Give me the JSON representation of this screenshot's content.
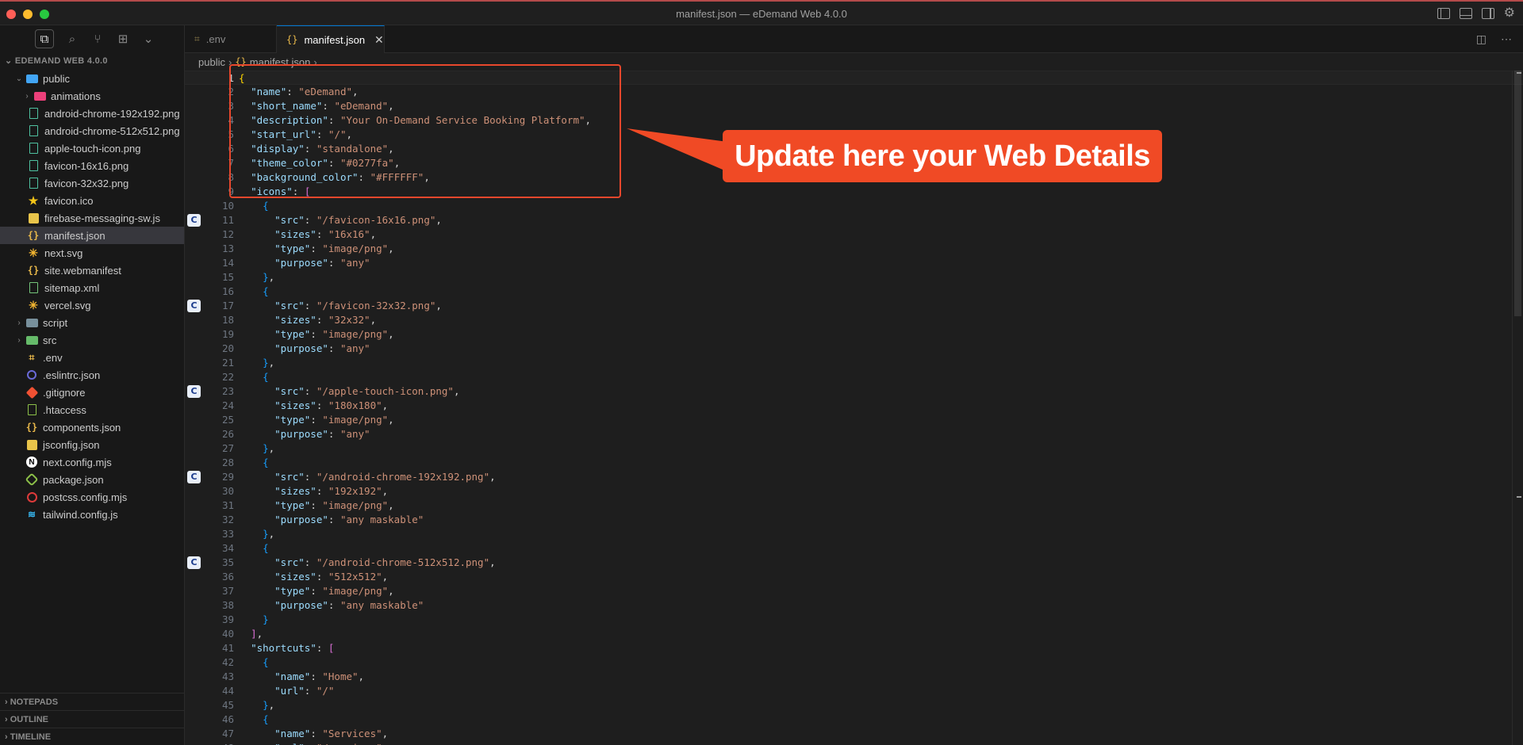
{
  "window": {
    "title": "manifest.json — eDemand Web 4.0.0"
  },
  "explorer": {
    "title": "EDEMAND WEB 4.0.0",
    "tree": [
      {
        "label": "public",
        "kind": "folder-open",
        "depth": 0,
        "color": "#42a5f5"
      },
      {
        "label": "animations",
        "kind": "folder",
        "depth": 1,
        "color": "#ec407a"
      },
      {
        "label": "android-chrome-192x192.png",
        "kind": "image",
        "depth": 1
      },
      {
        "label": "android-chrome-512x512.png",
        "kind": "image",
        "depth": 1
      },
      {
        "label": "apple-touch-icon.png",
        "kind": "image",
        "depth": 1
      },
      {
        "label": "favicon-16x16.png",
        "kind": "image",
        "depth": 1
      },
      {
        "label": "favicon-32x32.png",
        "kind": "image",
        "depth": 1
      },
      {
        "label": "favicon.ico",
        "kind": "star",
        "depth": 1
      },
      {
        "label": "firebase-messaging-sw.js",
        "kind": "js",
        "depth": 1
      },
      {
        "label": "manifest.json",
        "kind": "json",
        "depth": 1,
        "selected": true
      },
      {
        "label": "next.svg",
        "kind": "svg",
        "depth": 1
      },
      {
        "label": "site.webmanifest",
        "kind": "json",
        "depth": 1
      },
      {
        "label": "sitemap.xml",
        "kind": "xml",
        "depth": 1
      },
      {
        "label": "vercel.svg",
        "kind": "svg",
        "depth": 1
      },
      {
        "label": "script",
        "kind": "folder",
        "depth": 0,
        "color": "#78909c"
      },
      {
        "label": "src",
        "kind": "folder",
        "depth": 0,
        "color": "#66bb6a"
      },
      {
        "label": ".env",
        "kind": "env",
        "depth": 0
      },
      {
        "label": ".eslintrc.json",
        "kind": "eslint",
        "depth": 0
      },
      {
        "label": ".gitignore",
        "kind": "git",
        "depth": 0
      },
      {
        "label": ".htaccess",
        "kind": "htaccess",
        "depth": 0
      },
      {
        "label": "components.json",
        "kind": "json",
        "depth": 0
      },
      {
        "label": "jsconfig.json",
        "kind": "jsconfig",
        "depth": 0
      },
      {
        "label": "next.config.mjs",
        "kind": "next",
        "depth": 0
      },
      {
        "label": "package.json",
        "kind": "package",
        "depth": 0
      },
      {
        "label": "postcss.config.mjs",
        "kind": "postcss",
        "depth": 0
      },
      {
        "label": "tailwind.config.js",
        "kind": "tailwind",
        "depth": 0
      }
    ],
    "bottom_panels": [
      "NOTEPADS",
      "OUTLINE",
      "TIMELINE"
    ]
  },
  "tabs": [
    {
      "label": ".env",
      "active": false
    },
    {
      "label": "manifest.json",
      "active": true
    }
  ],
  "breadcrumb": {
    "folder": "public",
    "file": "manifest.json"
  },
  "editor": {
    "current_line": 1,
    "lines": [
      [
        [
          "br1",
          "{"
        ]
      ],
      [
        [
          "i",
          "  "
        ],
        [
          "k",
          "\"name\""
        ],
        [
          "p",
          ": "
        ],
        [
          "s",
          "\"eDemand\""
        ],
        [
          "p",
          ","
        ]
      ],
      [
        [
          "i",
          "  "
        ],
        [
          "k",
          "\"short_name\""
        ],
        [
          "p",
          ": "
        ],
        [
          "s",
          "\"eDemand\""
        ],
        [
          "p",
          ","
        ]
      ],
      [
        [
          "i",
          "  "
        ],
        [
          "k",
          "\"description\""
        ],
        [
          "p",
          ": "
        ],
        [
          "s",
          "\"Your On-Demand Service Booking Platform\""
        ],
        [
          "p",
          ","
        ]
      ],
      [
        [
          "i",
          "  "
        ],
        [
          "k",
          "\"start_url\""
        ],
        [
          "p",
          ": "
        ],
        [
          "s",
          "\"/\""
        ],
        [
          "p",
          ","
        ]
      ],
      [
        [
          "i",
          "  "
        ],
        [
          "k",
          "\"display\""
        ],
        [
          "p",
          ": "
        ],
        [
          "s",
          "\"standalone\""
        ],
        [
          "p",
          ","
        ]
      ],
      [
        [
          "i",
          "  "
        ],
        [
          "k",
          "\"theme_color\""
        ],
        [
          "p",
          ": "
        ],
        [
          "s",
          "\"#0277fa\""
        ],
        [
          "p",
          ","
        ]
      ],
      [
        [
          "i",
          "  "
        ],
        [
          "k",
          "\"background_color\""
        ],
        [
          "p",
          ": "
        ],
        [
          "s",
          "\"#FFFFFF\""
        ],
        [
          "p",
          ","
        ]
      ],
      [
        [
          "i",
          "  "
        ],
        [
          "k",
          "\"icons\""
        ],
        [
          "p",
          ": "
        ],
        [
          "br2",
          "["
        ]
      ],
      [
        [
          "i",
          "    "
        ],
        [
          "br3",
          "{"
        ]
      ],
      [
        [
          "i",
          "      "
        ],
        [
          "k",
          "\"src\""
        ],
        [
          "p",
          ": "
        ],
        [
          "s",
          "\"/favicon-16x16.png\""
        ],
        [
          "p",
          ","
        ]
      ],
      [
        [
          "i",
          "      "
        ],
        [
          "k",
          "\"sizes\""
        ],
        [
          "p",
          ": "
        ],
        [
          "s",
          "\"16x16\""
        ],
        [
          "p",
          ","
        ]
      ],
      [
        [
          "i",
          "      "
        ],
        [
          "k",
          "\"type\""
        ],
        [
          "p",
          ": "
        ],
        [
          "s",
          "\"image/png\""
        ],
        [
          "p",
          ","
        ]
      ],
      [
        [
          "i",
          "      "
        ],
        [
          "k",
          "\"purpose\""
        ],
        [
          "p",
          ": "
        ],
        [
          "s",
          "\"any\""
        ]
      ],
      [
        [
          "i",
          "    "
        ],
        [
          "br3",
          "}"
        ],
        [
          "p",
          ","
        ]
      ],
      [
        [
          "i",
          "    "
        ],
        [
          "br3",
          "{"
        ]
      ],
      [
        [
          "i",
          "      "
        ],
        [
          "k",
          "\"src\""
        ],
        [
          "p",
          ": "
        ],
        [
          "s",
          "\"/favicon-32x32.png\""
        ],
        [
          "p",
          ","
        ]
      ],
      [
        [
          "i",
          "      "
        ],
        [
          "k",
          "\"sizes\""
        ],
        [
          "p",
          ": "
        ],
        [
          "s",
          "\"32x32\""
        ],
        [
          "p",
          ","
        ]
      ],
      [
        [
          "i",
          "      "
        ],
        [
          "k",
          "\"type\""
        ],
        [
          "p",
          ": "
        ],
        [
          "s",
          "\"image/png\""
        ],
        [
          "p",
          ","
        ]
      ],
      [
        [
          "i",
          "      "
        ],
        [
          "k",
          "\"purpose\""
        ],
        [
          "p",
          ": "
        ],
        [
          "s",
          "\"any\""
        ]
      ],
      [
        [
          "i",
          "    "
        ],
        [
          "br3",
          "}"
        ],
        [
          "p",
          ","
        ]
      ],
      [
        [
          "i",
          "    "
        ],
        [
          "br3",
          "{"
        ]
      ],
      [
        [
          "i",
          "      "
        ],
        [
          "k",
          "\"src\""
        ],
        [
          "p",
          ": "
        ],
        [
          "s",
          "\"/apple-touch-icon.png\""
        ],
        [
          "p",
          ","
        ]
      ],
      [
        [
          "i",
          "      "
        ],
        [
          "k",
          "\"sizes\""
        ],
        [
          "p",
          ": "
        ],
        [
          "s",
          "\"180x180\""
        ],
        [
          "p",
          ","
        ]
      ],
      [
        [
          "i",
          "      "
        ],
        [
          "k",
          "\"type\""
        ],
        [
          "p",
          ": "
        ],
        [
          "s",
          "\"image/png\""
        ],
        [
          "p",
          ","
        ]
      ],
      [
        [
          "i",
          "      "
        ],
        [
          "k",
          "\"purpose\""
        ],
        [
          "p",
          ": "
        ],
        [
          "s",
          "\"any\""
        ]
      ],
      [
        [
          "i",
          "    "
        ],
        [
          "br3",
          "}"
        ],
        [
          "p",
          ","
        ]
      ],
      [
        [
          "i",
          "    "
        ],
        [
          "br3",
          "{"
        ]
      ],
      [
        [
          "i",
          "      "
        ],
        [
          "k",
          "\"src\""
        ],
        [
          "p",
          ": "
        ],
        [
          "s",
          "\"/android-chrome-192x192.png\""
        ],
        [
          "p",
          ","
        ]
      ],
      [
        [
          "i",
          "      "
        ],
        [
          "k",
          "\"sizes\""
        ],
        [
          "p",
          ": "
        ],
        [
          "s",
          "\"192x192\""
        ],
        [
          "p",
          ","
        ]
      ],
      [
        [
          "i",
          "      "
        ],
        [
          "k",
          "\"type\""
        ],
        [
          "p",
          ": "
        ],
        [
          "s",
          "\"image/png\""
        ],
        [
          "p",
          ","
        ]
      ],
      [
        [
          "i",
          "      "
        ],
        [
          "k",
          "\"purpose\""
        ],
        [
          "p",
          ": "
        ],
        [
          "s",
          "\"any maskable\""
        ]
      ],
      [
        [
          "i",
          "    "
        ],
        [
          "br3",
          "}"
        ],
        [
          "p",
          ","
        ]
      ],
      [
        [
          "i",
          "    "
        ],
        [
          "br3",
          "{"
        ]
      ],
      [
        [
          "i",
          "      "
        ],
        [
          "k",
          "\"src\""
        ],
        [
          "p",
          ": "
        ],
        [
          "s",
          "\"/android-chrome-512x512.png\""
        ],
        [
          "p",
          ","
        ]
      ],
      [
        [
          "i",
          "      "
        ],
        [
          "k",
          "\"sizes\""
        ],
        [
          "p",
          ": "
        ],
        [
          "s",
          "\"512x512\""
        ],
        [
          "p",
          ","
        ]
      ],
      [
        [
          "i",
          "      "
        ],
        [
          "k",
          "\"type\""
        ],
        [
          "p",
          ": "
        ],
        [
          "s",
          "\"image/png\""
        ],
        [
          "p",
          ","
        ]
      ],
      [
        [
          "i",
          "      "
        ],
        [
          "k",
          "\"purpose\""
        ],
        [
          "p",
          ": "
        ],
        [
          "s",
          "\"any maskable\""
        ]
      ],
      [
        [
          "i",
          "    "
        ],
        [
          "br3",
          "}"
        ]
      ],
      [
        [
          "i",
          "  "
        ],
        [
          "br2",
          "]"
        ],
        [
          "p",
          ","
        ]
      ],
      [
        [
          "i",
          "  "
        ],
        [
          "k",
          "\"shortcuts\""
        ],
        [
          "p",
          ": "
        ],
        [
          "br2",
          "["
        ]
      ],
      [
        [
          "i",
          "    "
        ],
        [
          "br3",
          "{"
        ]
      ],
      [
        [
          "i",
          "      "
        ],
        [
          "k",
          "\"name\""
        ],
        [
          "p",
          ": "
        ],
        [
          "s",
          "\"Home\""
        ],
        [
          "p",
          ","
        ]
      ],
      [
        [
          "i",
          "      "
        ],
        [
          "k",
          "\"url\""
        ],
        [
          "p",
          ": "
        ],
        [
          "s",
          "\"/\""
        ]
      ],
      [
        [
          "i",
          "    "
        ],
        [
          "br3",
          "}"
        ],
        [
          "p",
          ","
        ]
      ],
      [
        [
          "i",
          "    "
        ],
        [
          "br3",
          "{"
        ]
      ],
      [
        [
          "i",
          "      "
        ],
        [
          "k",
          "\"name\""
        ],
        [
          "p",
          ": "
        ],
        [
          "s",
          "\"Services\""
        ],
        [
          "p",
          ","
        ]
      ],
      [
        [
          "i",
          "      "
        ],
        [
          "k",
          "\"url\""
        ],
        [
          "p",
          ": "
        ],
        [
          "s",
          "\"/services\""
        ]
      ]
    ],
    "gutter_glyph_lines": [
      11,
      17,
      23,
      29,
      35
    ],
    "gutter_glyph_char": "C"
  },
  "annotation": {
    "text": "Update here your Web Details",
    "color": "#f04a25"
  }
}
